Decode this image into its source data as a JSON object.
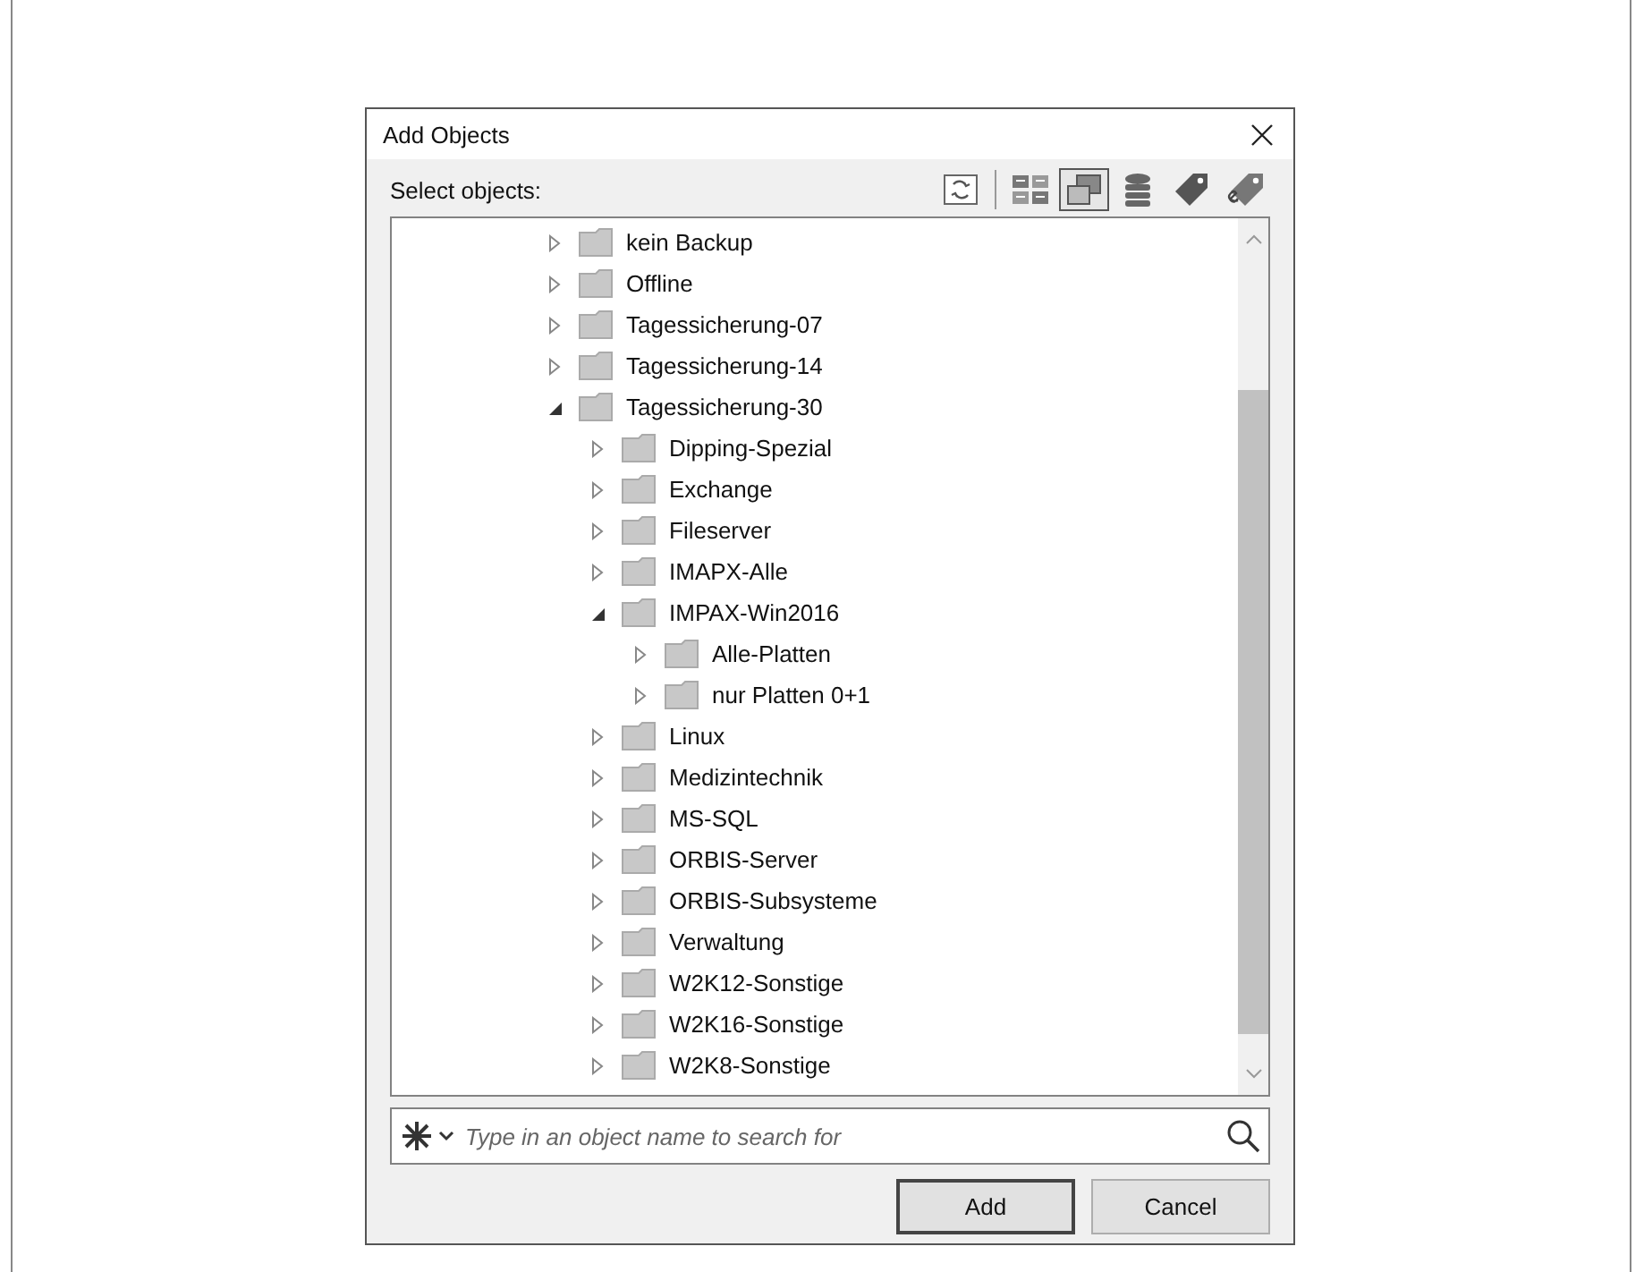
{
  "window": {
    "title": "Add Objects"
  },
  "toolbar": {
    "label": "Select objects:",
    "buttons": [
      {
        "kind": "refresh",
        "selected": false
      },
      {
        "kind": "details",
        "selected": false
      },
      {
        "kind": "overlap",
        "selected": true
      },
      {
        "kind": "database",
        "selected": false
      },
      {
        "kind": "tag",
        "selected": false
      },
      {
        "kind": "tags",
        "selected": false
      }
    ]
  },
  "tree": {
    "items": [
      {
        "label": "kein Backup",
        "expanded": false
      },
      {
        "label": "Offline",
        "expanded": false
      },
      {
        "label": "Tagessicherung-07",
        "expanded": false
      },
      {
        "label": "Tagessicherung-14",
        "expanded": false
      },
      {
        "label": "Tagessicherung-30",
        "expanded": true,
        "children": [
          {
            "label": "Dipping-Spezial",
            "expanded": false
          },
          {
            "label": "Exchange",
            "expanded": false
          },
          {
            "label": "Fileserver",
            "expanded": false
          },
          {
            "label": "IMAPX-Alle",
            "expanded": false
          },
          {
            "label": "IMPAX-Win2016",
            "expanded": true,
            "children": [
              {
                "label": "Alle-Platten",
                "expanded": false
              },
              {
                "label": "nur Platten 0+1",
                "expanded": false
              }
            ]
          },
          {
            "label": "Linux",
            "expanded": false
          },
          {
            "label": "Medizintechnik",
            "expanded": false
          },
          {
            "label": "MS-SQL",
            "expanded": false
          },
          {
            "label": "ORBIS-Server",
            "expanded": false
          },
          {
            "label": "ORBIS-Subsysteme",
            "expanded": false
          },
          {
            "label": "Verwaltung",
            "expanded": false
          },
          {
            "label": "W2K12-Sonstige",
            "expanded": false
          },
          {
            "label": "W2K16-Sonstige",
            "expanded": false
          },
          {
            "label": "W2K8-Sonstige",
            "expanded": false
          }
        ]
      }
    ]
  },
  "search": {
    "placeholder": "Type in an object name to search for"
  },
  "buttons": [
    {
      "label": "Add",
      "kind": "default"
    },
    {
      "label": "Cancel",
      "kind": "normal"
    }
  ]
}
